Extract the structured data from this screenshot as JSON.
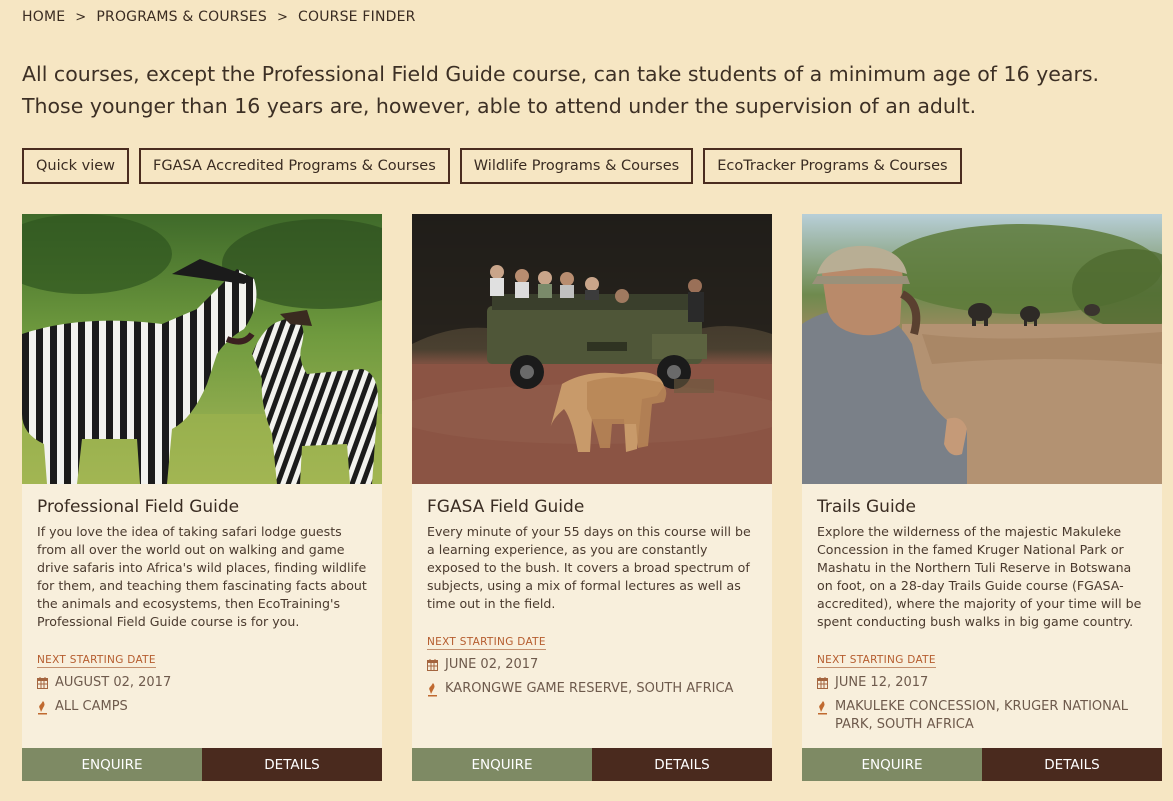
{
  "breadcrumb": {
    "items": [
      "HOME",
      "PROGRAMS & COURSES",
      "COURSE FINDER"
    ],
    "separator": ">"
  },
  "intro": {
    "text": "All courses, except the Professional Field Guide course, can take students of a minimum age of 16 years. Those younger than 16 years are, however, able to attend under the supervision of an adult."
  },
  "filters": [
    "Quick view",
    "FGASA Accredited Programs & Courses",
    "Wildlife Programs & Courses",
    "EcoTracker Programs & Courses"
  ],
  "courses": [
    {
      "title": "Professional Field Guide",
      "description": "If you love the idea of taking safari lodge guests from all over the world out on walking and game drive safaris into Africa's wild places, finding wildlife for them, and teaching them fascinating facts about the animals and ecosystems, then EcoTraining's Professional Field Guide course is for you.",
      "next_label": "NEXT STARTING DATE",
      "date": "AUGUST 02, 2017",
      "location": "ALL CAMPS",
      "enquire": "ENQUIRE",
      "details": "DETAILS",
      "image": "zebras"
    },
    {
      "title": "FGASA Field Guide",
      "description": "Every minute of your 55 days on this course will be a learning experience, as you are constantly exposed to the bush. It covers a broad spectrum of subjects, using a mix of formal lectures as well as time out in the field.",
      "next_label": "NEXT STARTING DATE",
      "date": "JUNE 02, 2017",
      "location": "KARONGWE GAME RESERVE, SOUTH AFRICA",
      "enquire": "ENQUIRE",
      "details": "DETAILS",
      "image": "lions-and-game-vehicle"
    },
    {
      "title": "Trails Guide",
      "description": "Explore the wilderness of the majestic Makuleke Concession in the famed Kruger National Park or Mashatu in the Northern Tuli Reserve in Botswana on foot, on a 28-day Trails Guide course (FGASA-accredited), where the majority of your time will be spent conducting bush walks in big game country.",
      "next_label": "NEXT STARTING DATE",
      "date": "JUNE 12, 2017",
      "location": "MAKULEKE CONCESSION, KRUGER NATIONAL PARK, SOUTH AFRICA",
      "enquire": "ENQUIRE",
      "details": "DETAILS",
      "image": "guide-watching-elephants"
    }
  ],
  "icons": {
    "calendar": "calendar-icon",
    "location": "location-pin-icon",
    "chevron": "chevron-right-icon"
  },
  "colors": {
    "page_bg": "#f6e6c3",
    "card_bg": "#f8efdc",
    "enquire_bg": "#7e8a64",
    "details_bg": "#4a2a1e",
    "accent": "#b55c2e",
    "border": "#4a2c1f"
  }
}
